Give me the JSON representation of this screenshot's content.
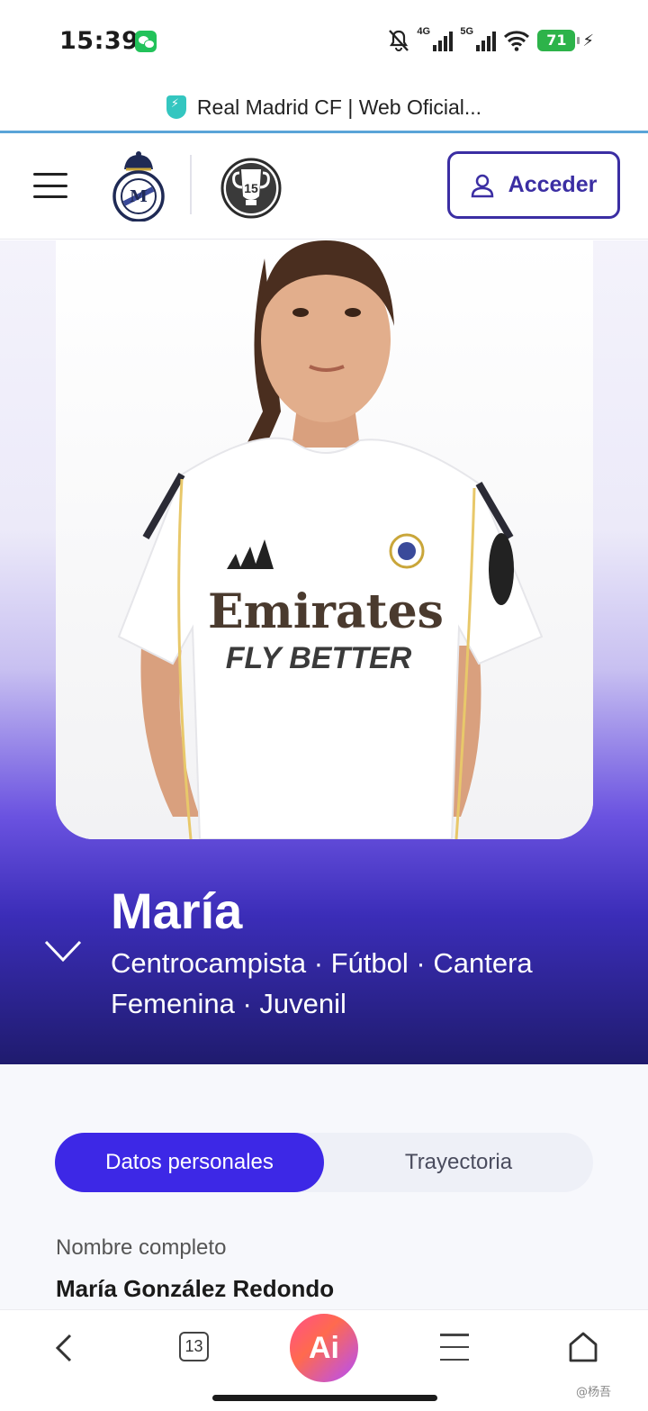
{
  "status_bar": {
    "time": "15:39",
    "signal_1_label": "4G",
    "signal_2_label": "5G",
    "battery": "71",
    "icons": [
      "wechat-icon",
      "bell-muted-icon",
      "signal-icon",
      "wifi-icon",
      "battery-icon",
      "charging-icon"
    ]
  },
  "browser": {
    "title": "Real Madrid CF | Web Oficial..."
  },
  "header": {
    "login_label": "Acceder",
    "trophy_number": "15",
    "accent_color": "#3b2ea3"
  },
  "player": {
    "name": "María",
    "meta": "Centrocampista · Fútbol · Cantera Femenina · Juvenil",
    "jersey_sponsor": "Emirates",
    "jersey_tagline": "FLY BETTER"
  },
  "tabs": {
    "active": "Datos personales",
    "inactive": "Trayectoria",
    "active_color": "#3d28e6"
  },
  "details": {
    "label": "Nombre completo",
    "value": "María González Redondo"
  },
  "bottom_nav": {
    "tab_count": "13",
    "ai_label": "Ai",
    "watermark": "@杨吾"
  }
}
